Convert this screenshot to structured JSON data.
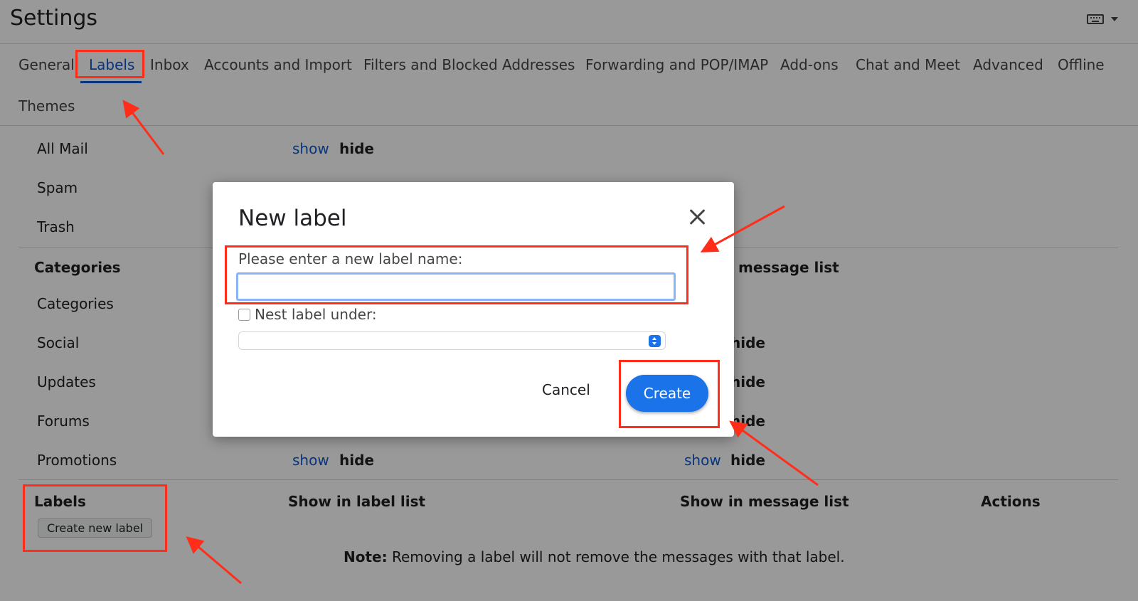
{
  "header": {
    "title": "Settings"
  },
  "tabs": [
    {
      "label": "General"
    },
    {
      "label": "Labels"
    },
    {
      "label": "Inbox"
    },
    {
      "label": "Accounts and Import"
    },
    {
      "label": "Filters and Blocked Addresses"
    },
    {
      "label": "Forwarding and POP/IMAP"
    },
    {
      "label": "Add-ons"
    },
    {
      "label": "Chat and Meet"
    },
    {
      "label": "Advanced"
    },
    {
      "label": "Offline"
    },
    {
      "label": "Themes"
    }
  ],
  "system_labels": {
    "rows": [
      {
        "name": "All Mail",
        "show": "show",
        "hide": "hide"
      },
      {
        "name": "Spam"
      },
      {
        "name": "Trash"
      }
    ]
  },
  "categories": {
    "heading": "Categories",
    "col_message_list": "message list",
    "rows": [
      {
        "name": "Categories"
      },
      {
        "name": "Social",
        "msg_hide": "hide"
      },
      {
        "name": "Updates",
        "msg_hide": "hide"
      },
      {
        "name": "Forums",
        "msg_hide": "hide"
      },
      {
        "name": "Promotions",
        "show": "show",
        "hide": "hide",
        "msg_show": "show",
        "msg_hide": "hide"
      }
    ]
  },
  "labels_section": {
    "heading": "Labels",
    "col_label_list": "Show in label list",
    "col_message_list": "Show in message list",
    "col_actions": "Actions",
    "create_button": "Create new label",
    "note_bold": "Note:",
    "note_text": " Removing a label will not remove the messages with that label."
  },
  "dialog": {
    "title": "New label",
    "name_label": "Please enter a new label name:",
    "name_value": "",
    "nest_label": "Nest label under:",
    "nest_checked": false,
    "nest_selected": "",
    "cancel": "Cancel",
    "create": "Create"
  },
  "colors": {
    "accent": "#1a73e8",
    "link": "#0b57d0",
    "annotation": "#ff2d1a"
  }
}
